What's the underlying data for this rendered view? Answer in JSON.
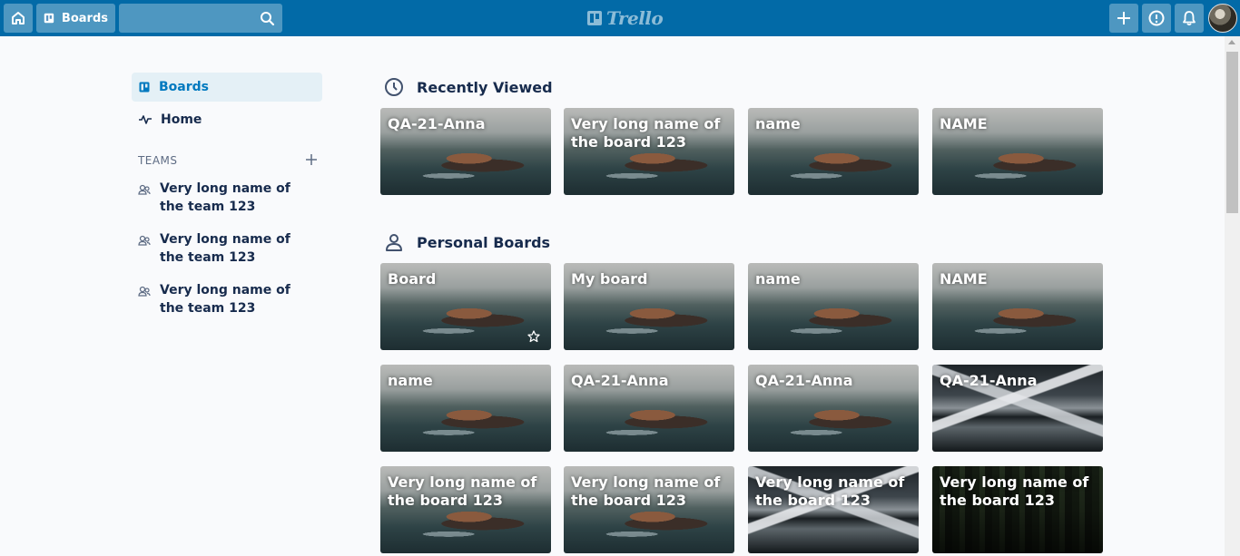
{
  "header": {
    "boards_label": "Boards",
    "search_placeholder": "",
    "logo_text": "Trello"
  },
  "sidebar": {
    "boards_label": "Boards",
    "home_label": "Home",
    "teams_header": "TEAMS",
    "teams": [
      {
        "name": "Very long name of the team 123"
      },
      {
        "name": "Very long name of the team 123"
      },
      {
        "name": "Very long name of the team 123"
      }
    ]
  },
  "recently_viewed": {
    "title": "Recently Viewed",
    "boards": [
      {
        "title": "QA-21-Anna",
        "background": "coast"
      },
      {
        "title": "Very long name of the board 123",
        "background": "coast"
      },
      {
        "title": "name",
        "background": "coast"
      },
      {
        "title": "NAME",
        "background": "coast"
      }
    ]
  },
  "personal_boards": {
    "title": "Personal Boards",
    "boards": [
      {
        "title": "Board",
        "background": "coast",
        "star": true
      },
      {
        "title": "My board",
        "background": "coast"
      },
      {
        "title": "name",
        "background": "coast"
      },
      {
        "title": "NAME",
        "background": "coast"
      },
      {
        "title": "name",
        "background": "coast"
      },
      {
        "title": "QA-21-Anna",
        "background": "coast"
      },
      {
        "title": "QA-21-Anna",
        "background": "coast"
      },
      {
        "title": "QA-21-Anna",
        "background": "mountain"
      },
      {
        "title": "Very long name of the board 123",
        "background": "coast"
      },
      {
        "title": "Very long name of the board 123",
        "background": "coast"
      },
      {
        "title": "Very long name of the board 123",
        "background": "mountain"
      },
      {
        "title": "Very long name of the board 123",
        "background": "forest"
      }
    ]
  },
  "colors": {
    "header": "#026aa7",
    "accent": "#0079bf",
    "selected_bg": "#e4f0f6",
    "text": "#172b4d"
  },
  "icons": {
    "home": "home-icon",
    "boards": "boards-icon",
    "search": "search-icon",
    "plus": "plus-icon",
    "info": "info-icon",
    "bell": "bell-icon",
    "clock": "clock-icon",
    "person": "person-icon",
    "team": "team-icon",
    "activity": "activity-icon",
    "star": "star-icon"
  }
}
